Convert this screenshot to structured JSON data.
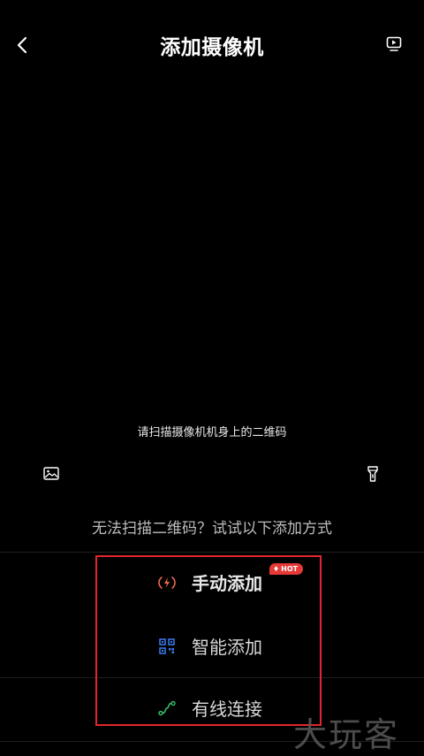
{
  "header": {
    "title": "添加摄像机",
    "back_icon": "chevron-left-icon",
    "play_icon": "video-play-icon"
  },
  "scanner": {
    "hint": "请扫描摄像机机身上的二维码",
    "gallery_icon": "image-icon",
    "flash_icon": "flashlight-icon"
  },
  "alternatives": {
    "hint": "无法扫描二维码？试试以下添加方式",
    "options": [
      {
        "label": "手动添加",
        "icon": "wireless-signal-icon",
        "icon_color": "#f06a4e",
        "badge": "HOT"
      },
      {
        "label": "智能添加",
        "icon": "qr-code-icon",
        "icon_color": "#3d7cf4"
      },
      {
        "label": "有线连接",
        "icon": "cable-icon",
        "icon_color": "#37c36b"
      }
    ]
  },
  "watermark": "大玩客",
  "colors": {
    "background": "#000000",
    "highlight": "#e3262d",
    "badge": "#e53935"
  }
}
